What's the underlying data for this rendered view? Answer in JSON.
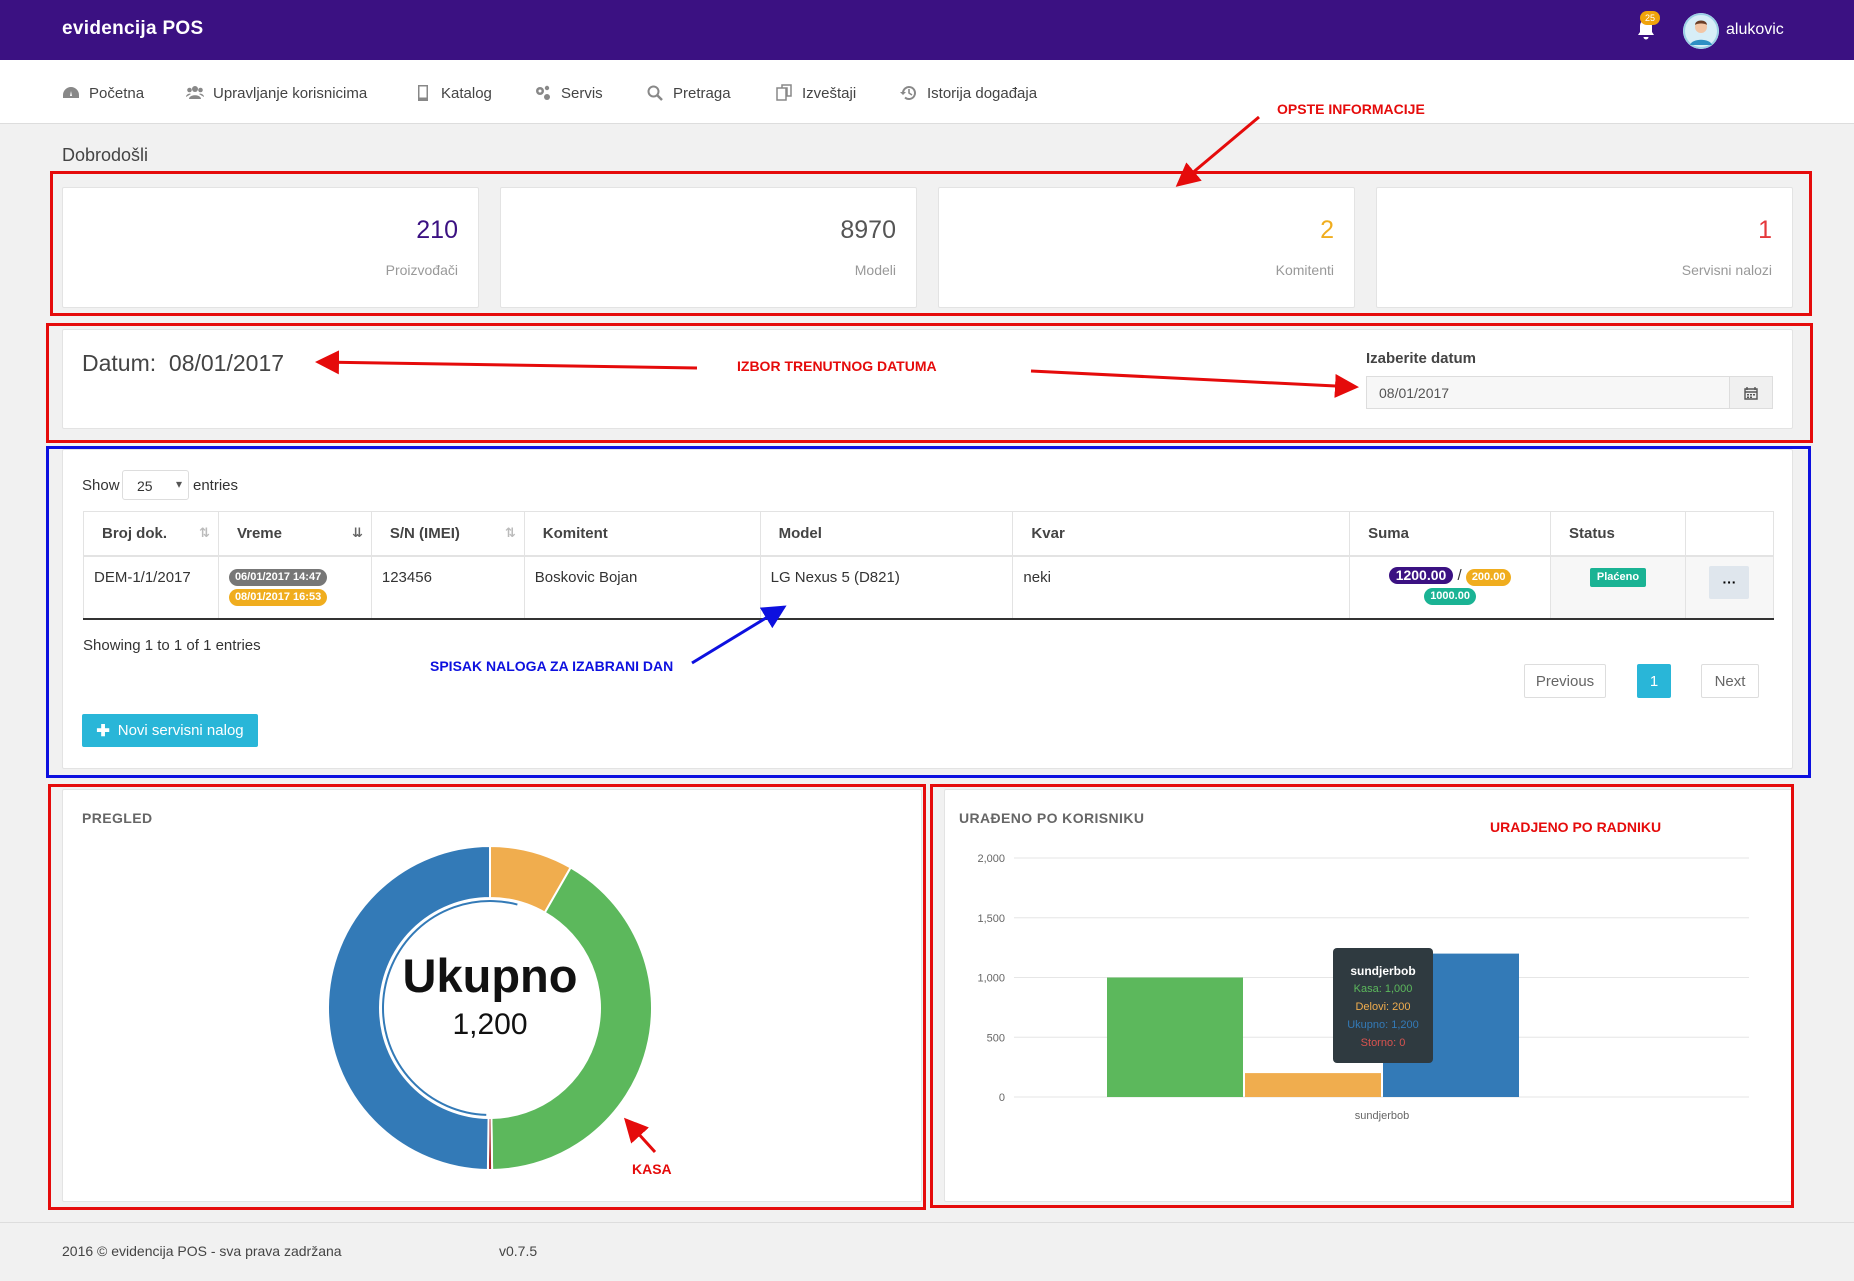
{
  "app": {
    "title": "evidencija POS",
    "notification_count": "25",
    "username": "alukovic"
  },
  "nav": [
    {
      "label": "Početna",
      "icon": "dashboard-icon"
    },
    {
      "label": "Upravljanje korisnicima",
      "icon": "users-icon"
    },
    {
      "label": "Katalog",
      "icon": "tablet-icon"
    },
    {
      "label": "Servis",
      "icon": "cogs-icon"
    },
    {
      "label": "Pretraga",
      "icon": "search-icon"
    },
    {
      "label": "Izveštaji",
      "icon": "copy-icon"
    },
    {
      "label": "Istorija događaja",
      "icon": "history-icon"
    }
  ],
  "welcome": "Dobrodošli",
  "stats": [
    {
      "value": "210",
      "label": "Proizvođači",
      "color": "#3b1182"
    },
    {
      "value": "8970",
      "label": "Modeli",
      "color": "#555555"
    },
    {
      "value": "2",
      "label": "Komitenti",
      "color": "#f0ad1e"
    },
    {
      "value": "1",
      "label": "Servisni nalozi",
      "color": "#e5383b"
    }
  ],
  "date_section": {
    "title_prefix": "Datum:",
    "title_value": "08/01/2017",
    "picker_label": "Izaberite datum",
    "picker_value": "08/01/2017"
  },
  "table": {
    "show_label": "Show",
    "page_size": "25",
    "entries_label": "entries",
    "columns": [
      "Broj dok.",
      "Vreme",
      "S/N (IMEI)",
      "Komitent",
      "Model",
      "Kvar",
      "Suma",
      "Status",
      ""
    ],
    "rows": [
      {
        "broj": "DEM-1/1/2017",
        "vreme_1": "06/01/2017 14:47",
        "vreme_2": "08/01/2017 16:53",
        "imei": "123456",
        "komitent": "Boskovic Bojan",
        "model": "LG Nexus 5 (D821)",
        "kvar": "neki",
        "suma_total": "1200.00",
        "suma_sep": "/",
        "suma_parts": "200.00",
        "suma_cash": "1000.00",
        "status": "Plaćeno",
        "actions": "···"
      }
    ],
    "showing": "Showing 1 to 1 of 1 entries",
    "pagination": {
      "previous": "Previous",
      "current": "1",
      "next": "Next"
    },
    "new_button": "Novi servisni nalog"
  },
  "donut": {
    "title": "PREGLED",
    "center_label": "Ukupno",
    "center_value": "1,200"
  },
  "bar": {
    "title": "URAĐENO PO KORISNIKU",
    "tooltip": {
      "title": "sundjerbob",
      "lines": [
        "Kasa: 1,000",
        "Delovi: 200",
        "Ukupno: 1,200",
        "Storno: 0"
      ]
    }
  },
  "chart_data": [
    {
      "type": "pie",
      "title": "PREGLED",
      "series": [
        {
          "name": "Kasa",
          "value": 1000,
          "color": "#5cb85c"
        },
        {
          "name": "Delovi",
          "value": 200,
          "color": "#f0ad4e"
        },
        {
          "name": "Ukupno",
          "value": 1200,
          "color": "#337ab7"
        },
        {
          "name": "Storno",
          "value": 10,
          "color": "#a3292a"
        }
      ]
    },
    {
      "type": "bar",
      "title": "URAĐENO PO KORISNIKU",
      "categories": [
        "sundjerbob"
      ],
      "series": [
        {
          "name": "Kasa",
          "values": [
            1000
          ],
          "color": "#5cb85c"
        },
        {
          "name": "Delovi",
          "values": [
            200
          ],
          "color": "#f0ad4e"
        },
        {
          "name": "Ukupno",
          "values": [
            1200
          ],
          "color": "#337ab7"
        },
        {
          "name": "Storno",
          "values": [
            0
          ],
          "color": "#d9534f"
        }
      ],
      "yticks": [
        "0",
        "500",
        "1,000",
        "1,500",
        "2,000"
      ],
      "ylim": [
        0,
        2000
      ],
      "grid": true
    }
  ],
  "annotations": {
    "opste": "OPSTE INFORMACIJE",
    "izbor": "IZBOR TRENUTNOG DATUMA",
    "spisak": "SPISAK NALOGA ZA IZABRANI DAN",
    "kasa": "KASA",
    "uradjeno": "URADJENO PO RADNIKU"
  },
  "footer": {
    "copyright": "2016 © evidencija POS - sva prava zadržana",
    "version": "v0.7.5"
  }
}
